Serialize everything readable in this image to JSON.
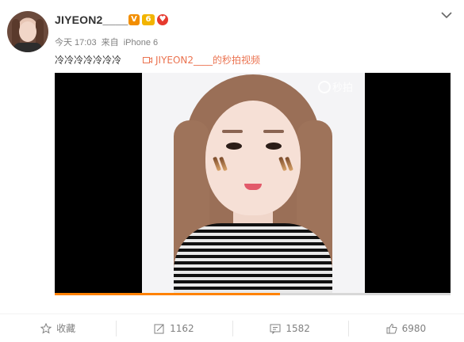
{
  "post": {
    "username": "JIYEON2____",
    "meta": {
      "time": "今天 17:03",
      "source_prefix": "来自",
      "device": "iPhone 6"
    },
    "text": "冷冷冷冷冷冷冷",
    "video_link": "JIYEON2____的秒拍视频"
  },
  "badges": [
    {
      "icon": "verified-v-icon",
      "label": "V",
      "color": "#f28e00"
    },
    {
      "icon": "vip-crown-icon",
      "label": "6",
      "color": "#f2b400"
    },
    {
      "icon": "red-heart-badge-icon",
      "label": "♥",
      "color": "#e63a2e"
    }
  ],
  "player": {
    "watermark": "秒拍",
    "progress": 0.57
  },
  "actions": {
    "favorite": {
      "label": "收藏",
      "icon": "star-icon"
    },
    "repost": {
      "count": "1162",
      "icon": "repost-icon"
    },
    "comment": {
      "count": "1582",
      "icon": "comment-icon"
    },
    "like": {
      "count": "6980",
      "icon": "thumbs-up-icon"
    }
  },
  "colors": {
    "link": "#eb7350",
    "progress": "#ff8200",
    "muted": "#808080"
  }
}
